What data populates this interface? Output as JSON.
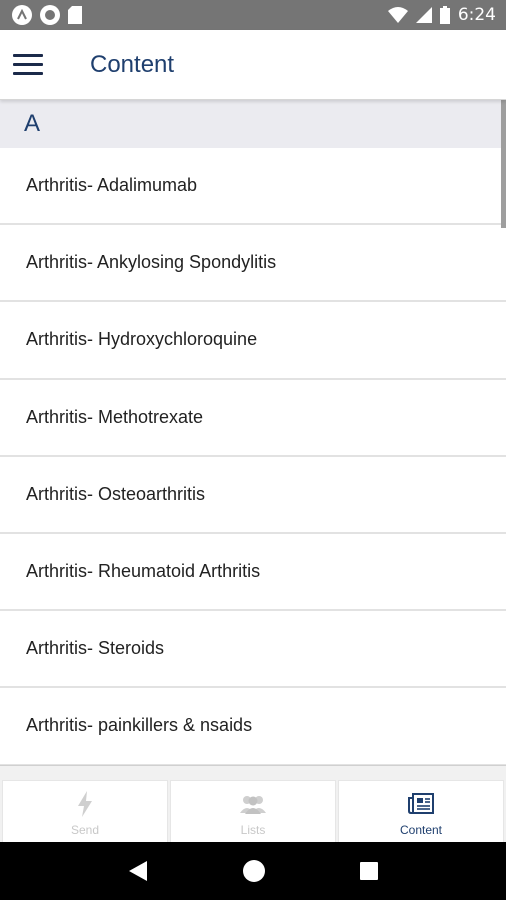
{
  "status_bar": {
    "time": "6:24"
  },
  "app_bar": {
    "title": "Content"
  },
  "section": {
    "letter": "A"
  },
  "items": [
    "Arthritis- Adalimumab",
    "Arthritis- Ankylosing Spondylitis",
    "Arthritis- Hydroxychloroquine",
    "Arthritis- Methotrexate",
    "Arthritis- Osteoarthritis",
    "Arthritis- Rheumatoid Arthritis",
    "Arthritis- Steroids",
    "Arthritis- painkillers & nsaids"
  ],
  "tabs": [
    {
      "label": "Send",
      "icon": "lightning-icon",
      "active": false
    },
    {
      "label": "Lists",
      "icon": "people-icon",
      "active": false
    },
    {
      "label": "Content",
      "icon": "newspaper-icon",
      "active": true
    }
  ],
  "colors": {
    "accent": "#1f3f6e",
    "statusbar": "#757575",
    "section_bg": "#ebebf0"
  }
}
